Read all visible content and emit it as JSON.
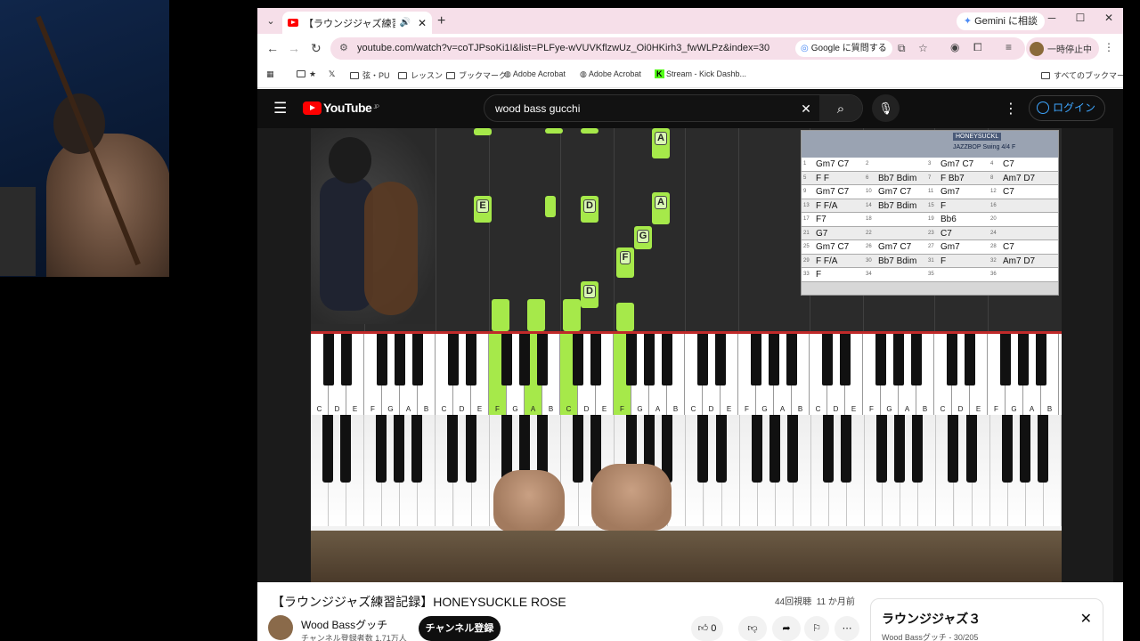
{
  "browser": {
    "tab_title": "【ラウンジジャズ練習記録】HONEYSUCKLE ROSE",
    "gemini_label": "Gemini に相談",
    "url": "youtube.com/watch?v=coTJPsoKi1I&list=PLFye-wVUVKflzwUz_Oi0HKirh3_fwWLPz&index=30",
    "ask_google": "Google に質問する",
    "profile_label": "一時停止中",
    "bookmarks": [
      "★",
      "弦・PU",
      "レッスン",
      "ブックマーク",
      "Adobe Acrobat",
      "Adobe Acrobat",
      "Stream - Kick Dashb..."
    ],
    "all_bookmarks": "すべてのブックマーク"
  },
  "youtube": {
    "logo": "YouTube",
    "region": "JP",
    "search_value": "wood bass gucchi",
    "login": "ログイン"
  },
  "video_overlay": {
    "falling_notes": [
      "A",
      "E",
      "D",
      "A",
      "G",
      "F",
      "D"
    ],
    "chart_title": "HONEYSUCKL",
    "chart_sub": "JAZZBOP Swing 4/4 F",
    "chords": [
      [
        "1",
        "Gm7 C7",
        "2",
        "",
        "3",
        "Gm7 C7",
        "4",
        "C7"
      ],
      [
        "5",
        "F  F",
        "6",
        "Bb7 Bdim",
        "7",
        "F  Bb7",
        "8",
        "Am7 D7"
      ],
      [
        "9",
        "Gm7 C7",
        "10",
        "Gm7 C7",
        "11",
        "Gm7",
        "12",
        "C7"
      ],
      [
        "13",
        "F  F/A",
        "14",
        "Bb7 Bdim",
        "15",
        "F",
        "16",
        ""
      ],
      [
        "17",
        "F7",
        "18",
        "",
        "19",
        "Bb6",
        "20",
        ""
      ],
      [
        "21",
        "G7",
        "22",
        "",
        "23",
        "C7",
        "24",
        ""
      ],
      [
        "25",
        "Gm7 C7",
        "26",
        "Gm7 C7",
        "27",
        "Gm7",
        "28",
        "C7"
      ],
      [
        "29",
        "F  F/A",
        "30",
        "Bb7 Bdim",
        "31",
        "F",
        "32",
        "Am7 D7"
      ],
      [
        "33",
        "F",
        "34",
        "",
        "35",
        "",
        "36",
        ""
      ]
    ],
    "key_letters": [
      "C",
      "D",
      "E",
      "F",
      "G",
      "A",
      "B"
    ]
  },
  "video": {
    "title": "【ラウンジジャズ練習記録】HONEYSUCKLE ROSE",
    "views": "44回視聴",
    "age": "11 か月前",
    "channel": "Wood Bassグッチ",
    "subscribers": "チャンネル登録者数 1.71万人",
    "subscribe": "チャンネル登録",
    "likes": "0"
  },
  "playlist": {
    "title": "ラウンジジャズ３",
    "meta": "Wood Bassグッチ - 30/205"
  }
}
